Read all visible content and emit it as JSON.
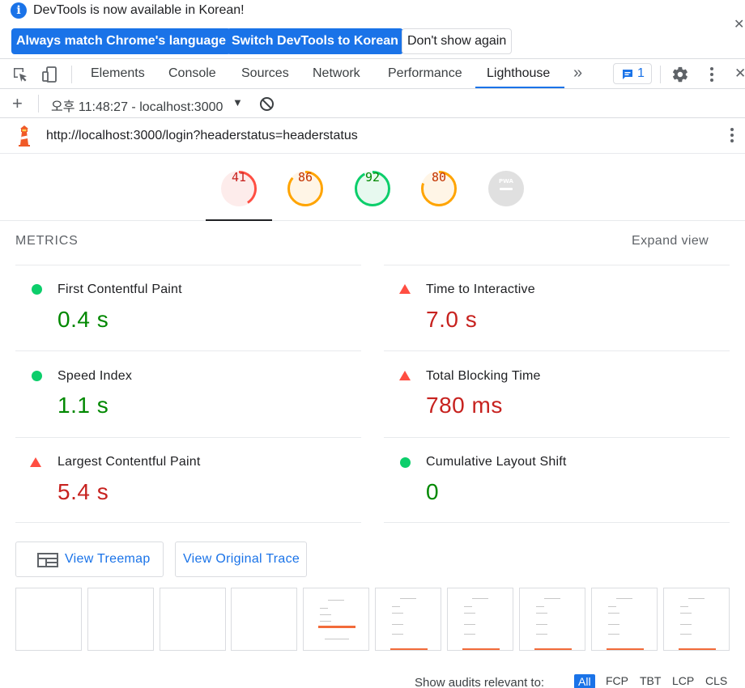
{
  "infobar": {
    "message": "DevTools is now available in Korean!",
    "buttons": {
      "match": "Always match Chrome's language",
      "switch": "Switch DevTools to Korean",
      "dismiss": "Don't show again"
    }
  },
  "tabs": {
    "items": [
      "Elements",
      "Console",
      "Sources",
      "Network",
      "Performance",
      "Lighthouse"
    ],
    "active": "Lighthouse",
    "more": "»",
    "issues_count": "1"
  },
  "report_toolbar": {
    "plus": "+",
    "report": "오후 11:48:27 - localhost:3000"
  },
  "url": "http://localhost:3000/login?headerstatus=headerstatus",
  "gauges": [
    {
      "label": "41",
      "score": 0.41,
      "color": "#ff4e42",
      "bg": "#fdeceb",
      "text_color": "#c7221f"
    },
    {
      "label": "86",
      "score": 0.86,
      "color": "#ffa400",
      "bg": "#fff5e6",
      "text_color": "#c33300"
    },
    {
      "label": "92",
      "score": 0.92,
      "color": "#0cce6b",
      "bg": "#e7f9ef",
      "text_color": "#008800"
    },
    {
      "label": "80",
      "score": 0.8,
      "color": "#ffa400",
      "bg": "#fff5e6",
      "text_color": "#c33300"
    },
    {
      "label": "PWA",
      "score": 0,
      "color": "#dadce0",
      "bg": "#e0e0e0",
      "text_color": "#9e9e9e"
    }
  ],
  "metrics": {
    "title": "METRICS",
    "expand": "Expand view",
    "items": [
      {
        "name": "First Contentful Paint",
        "value": "0.4 s",
        "status": "pass"
      },
      {
        "name": "Time to Interactive",
        "value": "7.0 s",
        "status": "fail"
      },
      {
        "name": "Speed Index",
        "value": "1.1 s",
        "status": "pass"
      },
      {
        "name": "Total Blocking Time",
        "value": "780 ms",
        "status": "fail"
      },
      {
        "name": "Largest Contentful Paint",
        "value": "5.4 s",
        "status": "fail"
      },
      {
        "name": "Cumulative Layout Shift",
        "value": "0",
        "status": "pass"
      }
    ]
  },
  "actions": {
    "treemap": "View Treemap",
    "trace": "View Original Trace"
  },
  "filter": {
    "label": "Show audits relevant to:",
    "chips": [
      "All",
      "FCP",
      "TBT",
      "LCP",
      "CLS"
    ],
    "active": "All"
  },
  "colors": {
    "pass": "#008800",
    "fail": "#c7221f",
    "accent": "#1a73e8"
  }
}
